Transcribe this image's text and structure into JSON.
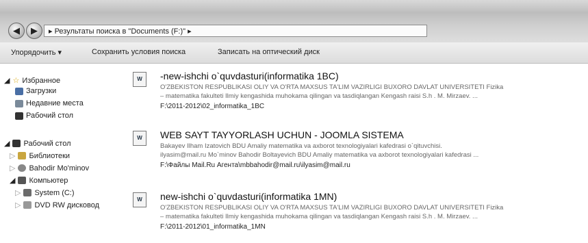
{
  "address": {
    "path": "Результаты поиска в \"Documents (F:)\""
  },
  "toolbar": {
    "organize": "Упорядочить ▾",
    "save_search": "Сохранить условия поиска",
    "burn": "Записать на оптический диск"
  },
  "nav": {
    "favorites": "Избранное",
    "downloads": "Загрузки",
    "recent": "Недавние места",
    "desktop_fav": "Рабочий стол",
    "desktop": "Рабочий стол",
    "libraries": "Библиотеки",
    "user": "Bahodir Mo'minov",
    "computer": "Компьютер",
    "system": "System (C:)",
    "dvd": "DVD RW дисковод"
  },
  "results": [
    {
      "title": "-new-ishchi o`quvdasturi(informatika 1BC)",
      "line1": "O'ZBEKISTON RESPUBLIKASI OLIY VA O'RTA MAXSUS TA'LIM VAZIRLIGI BUXORO DAVLAT UNIVERSITETI Fizika",
      "line2": "– matematika fakulteti Ilmiy kengashida muhokama qilingan va tasdiqlangan Kengash raisi S.h . M. Mirzaev. ...",
      "path": "F:\\2011-2012\\02_informatika_1BC"
    },
    {
      "title": "WEB SAYT TAYYORLASH UCHUN - JOOMLA SISTEMA",
      "line1": "Bakayev Ilham Izatovich BDU Amaliy matematika va axborot texnologiyalari kafedrasi o`qituvchisi.",
      "line2": "ilyasim@mail.ru Mo`minov Bahodir Boltayevich BDU Amaliy matematika va axborot texnologiyalari kafedrasi ...",
      "path": "F:\\Файлы Mail.Ru Агента\\mbbahodir@mail.ru\\ilyasim@mail.ru"
    },
    {
      "title": "new-ishchi o`quvdasturi(informatika 1MN)",
      "line1": "O'ZBEKISTON RESPUBLIKASI OLIY VA O'RTA MAXSUS TA'LIM VAZIRLIGI BUXORO DAVLAT UNIVERSITETI Fizika",
      "line2": "– matematika fakulteti Ilmiy kengashida muhokama qilingan va tasdiqlangan Kengash raisi S.h . M. Mirzaev. ...",
      "path": "F:\\2011-2012\\01_informatika_1MN"
    }
  ]
}
